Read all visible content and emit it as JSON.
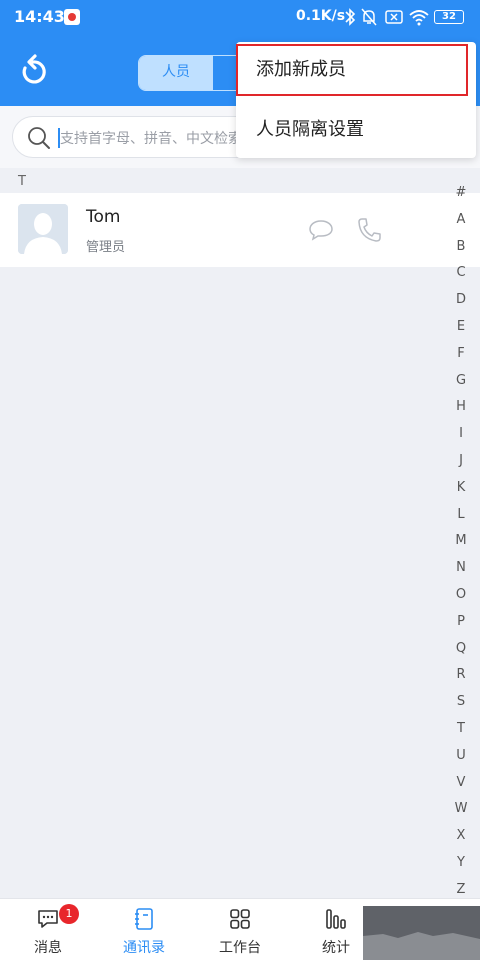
{
  "status_bar": {
    "time": "14:43",
    "network_speed": "0.1K/s",
    "battery": "32"
  },
  "header": {
    "tab_active": "人员"
  },
  "search": {
    "placeholder": "支持首字母、拼音、中文检索"
  },
  "section_letter": "T",
  "contacts": [
    {
      "name": "Tom",
      "role": "管理员"
    }
  ],
  "dropdown": {
    "items": [
      "添加新成员",
      "人员隔离设置"
    ]
  },
  "alphabet_index": [
    "#",
    "A",
    "B",
    "C",
    "D",
    "E",
    "F",
    "G",
    "H",
    "I",
    "J",
    "K",
    "L",
    "M",
    "N",
    "O",
    "P",
    "Q",
    "R",
    "S",
    "T",
    "U",
    "V",
    "W",
    "X",
    "Y",
    "Z"
  ],
  "bottom_nav": [
    {
      "label": "消息",
      "icon": "message-icon",
      "badge": "1"
    },
    {
      "label": "通讯录",
      "icon": "contacts-book-icon",
      "active": true
    },
    {
      "label": "工作台",
      "icon": "grid-icon"
    },
    {
      "label": "统计",
      "icon": "bar-chart-icon"
    }
  ],
  "colors": {
    "primary": "#2c8df4",
    "highlight_border": "#e0262a",
    "badge": "#e8262b"
  }
}
